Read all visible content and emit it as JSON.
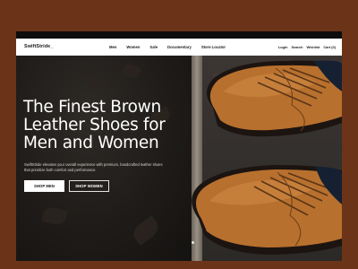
{
  "brand": {
    "name": "SwiftStride_"
  },
  "nav": {
    "links": [
      "Men",
      "Women",
      "Sale",
      "Documentary",
      "Store Locator"
    ],
    "login": "Login",
    "search": "Search",
    "wishlist": "Wishlist",
    "cart": "Cart (0)"
  },
  "hero": {
    "title": "The Finest Brown Leather Shoes for Men and Women",
    "description": "SwiftStride elevates your overall experience with premium, handcrafted leather shoes that prioritize both comfort and performance.",
    "shop_men": "SHOP MEN",
    "shop_women": "SHOP WOMEN"
  },
  "colors": {
    "page_background": "#6b3418",
    "navbar": "#ffffff",
    "shoe": "#b8702e",
    "button_primary": "#ffffff"
  }
}
